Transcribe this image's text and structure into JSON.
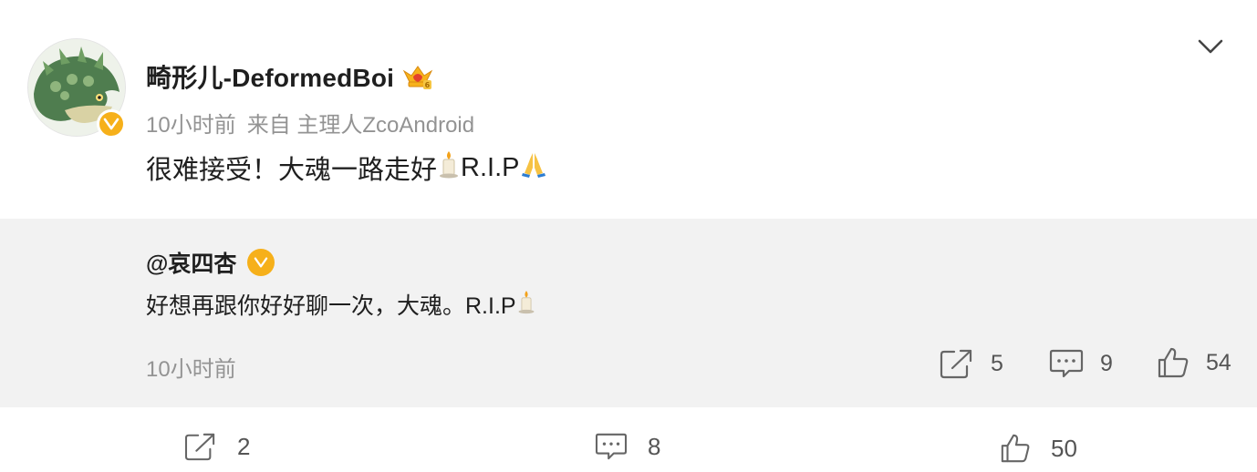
{
  "post": {
    "username": "畸形儿-DeformedBoi",
    "time": "10小时前",
    "source": "来自 主理人ZcoAndroid",
    "content_text": "很难接受！大魂一路走好",
    "content_tail": "R.I.P"
  },
  "repost": {
    "author": "@哀四杏",
    "content_text": "好想再跟你好好聊一次，大魂。R.I.P",
    "time": "10小时前",
    "repost_count": "5",
    "comment_count": "9",
    "like_count": "54"
  },
  "footer": {
    "repost_count": "2",
    "comment_count": "8",
    "like_count": "50"
  },
  "icons": {
    "verified": "verified-v-icon",
    "menu": "chevron-down-icon",
    "repost": "share-arrow-icon",
    "comment": "comment-bubble-icon",
    "like": "thumbs-up-icon"
  },
  "colors": {
    "verified_badge": "#f6b01a",
    "repost_background": "#f2f2f2",
    "muted_text": "#939393"
  }
}
